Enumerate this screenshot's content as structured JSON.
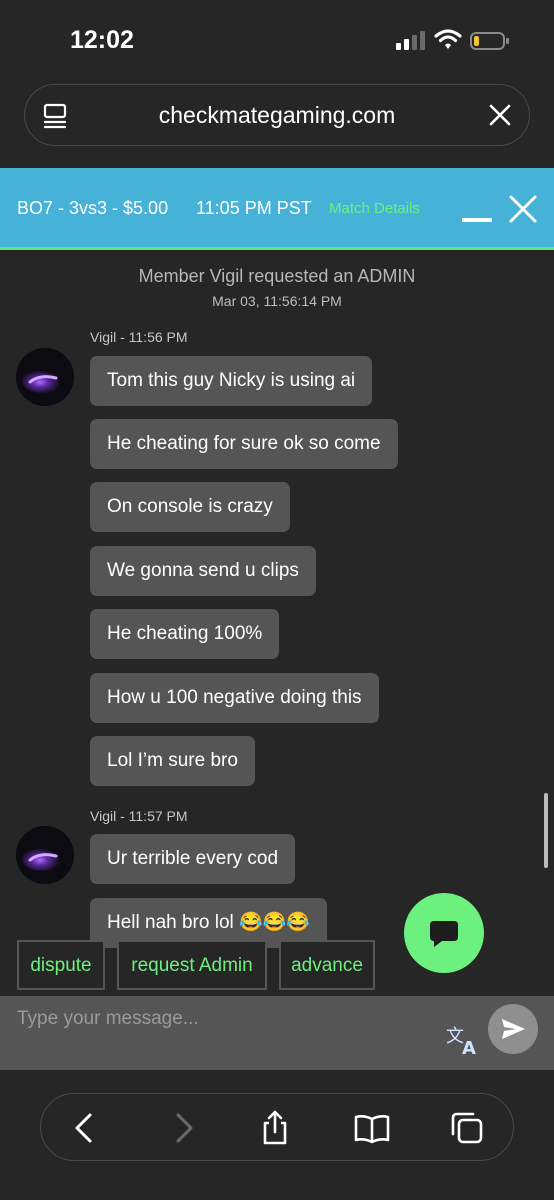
{
  "status_bar": {
    "time": "12:02"
  },
  "browser": {
    "url": "checkmategaming.com"
  },
  "match": {
    "info": "BO7 - 3vs3 - $5.00",
    "time": "11:05 PM PST",
    "details_link": "Match Details"
  },
  "chat": {
    "system_message": "Member Vigil requested an ADMIN",
    "system_timestamp": "Mar 03, 11:56:14 PM",
    "groups": [
      {
        "sender": "Vigil - 11:56 PM",
        "messages": [
          "Tom this guy Nicky is using ai",
          "He cheating for sure ok so come",
          "On console is crazy",
          "We gonna send u clips",
          "He cheating 100%",
          "How u 100 negative doing this",
          "Lol I’m sure bro"
        ]
      },
      {
        "sender": "Vigil - 11:57 PM",
        "messages": [
          "Ur terrible every cod",
          "Hell nah bro lol 😂😂😂"
        ]
      }
    ]
  },
  "actions": {
    "dispute": "dispute",
    "request_admin": "request Admin",
    "advance": "advance"
  },
  "input": {
    "placeholder": "Type your message..."
  },
  "colors": {
    "header_bg": "#46b2d8",
    "accent_green": "#6cf17f",
    "bubble_bg": "#555555",
    "page_bg": "#262626"
  },
  "icons": [
    "cellular-signal-icon",
    "wifi-icon",
    "battery-icon",
    "page-menu-icon",
    "close-icon",
    "minimize-icon",
    "chat-icon",
    "translate-icon",
    "send-icon",
    "back-icon",
    "forward-icon",
    "share-icon",
    "bookmarks-icon",
    "tabs-icon"
  ]
}
